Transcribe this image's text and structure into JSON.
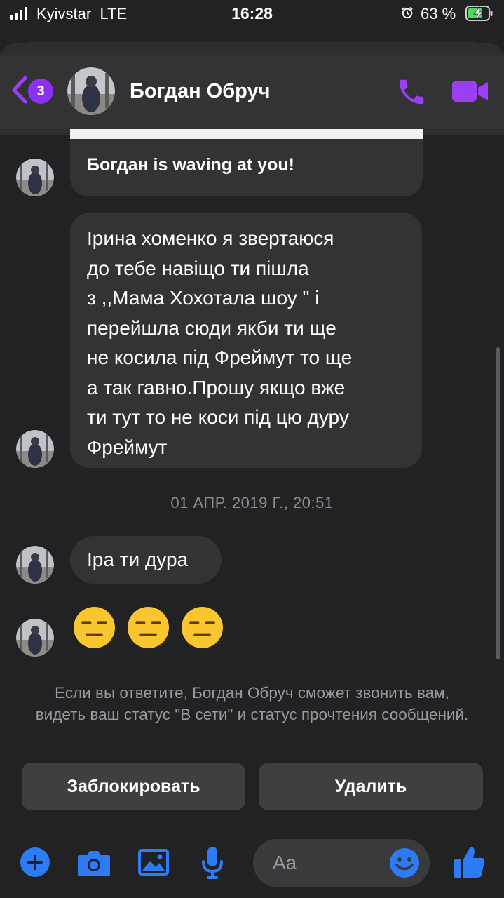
{
  "status_bar": {
    "carrier": "Kyivstar",
    "network": "LTE",
    "time": "16:28",
    "battery_percent": "63 %",
    "icons": [
      "signal-icon",
      "alarm-icon",
      "battery-charging-icon"
    ]
  },
  "header": {
    "back_badge": "3",
    "contact_name": "Богдан Обруч",
    "accent_color": "#9b3ff3",
    "icons": [
      "back-chevron-icon",
      "phone-icon",
      "video-camera-icon"
    ]
  },
  "messages": {
    "wave_text": "Богдан is waving at you!",
    "long_text": "Ірина хоменко я звертаюся\nдо тебе навіщо ти пішла\nз ,,Мама Хохотала шоу \" і\nперейшла сюди якби ти ще\nне косила під Фреймут то ще\nа так гавно.Прошу якщо вже\nти тут то не коси під цю дуру\nФреймут",
    "timestamp": "01 АПР. 2019 Г., 20:51",
    "short_text": "Іра ти дура",
    "emoji_reaction": "expressionless-face",
    "emoji_count": 3
  },
  "notice": {
    "text": "Если вы ответите, Богдан Обруч сможет звонить вам, видеть ваш статус \"В сети\" и статус прочтения сообщений."
  },
  "actions": {
    "block_label": "Заблокировать",
    "delete_label": "Удалить"
  },
  "composer": {
    "placeholder": "Aa",
    "icons": [
      "plus-icon",
      "camera-icon",
      "image-icon",
      "microphone-icon",
      "emoji-icon",
      "thumbs-up-icon"
    ],
    "icon_color": "#2e7bf6"
  }
}
